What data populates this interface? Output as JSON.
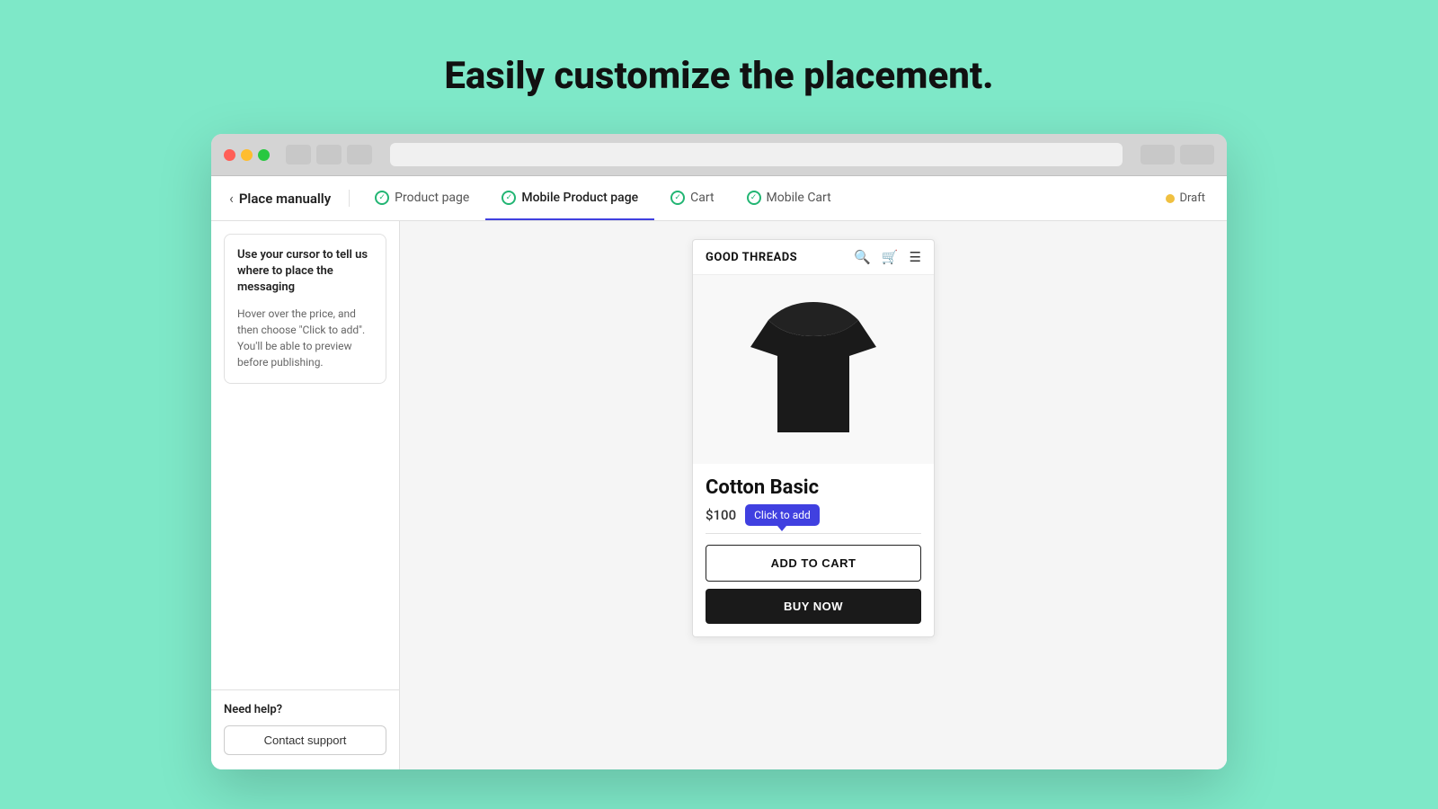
{
  "page": {
    "title": "Easily customize the placement.",
    "background_color": "#7ee8c8"
  },
  "browser": {
    "traffic_lights": [
      "red",
      "yellow",
      "green"
    ]
  },
  "app": {
    "back_label": "Place manually",
    "tabs": [
      {
        "id": "product-page",
        "label": "Product page",
        "active": false,
        "check": true
      },
      {
        "id": "mobile-product-page",
        "label": "Mobile Product page",
        "active": true,
        "check": true
      },
      {
        "id": "cart",
        "label": "Cart",
        "active": false,
        "check": true
      },
      {
        "id": "mobile-cart",
        "label": "Mobile Cart",
        "active": false,
        "check": true
      }
    ],
    "draft_badge": "Draft"
  },
  "sidebar": {
    "info_title": "Use your cursor to tell us where to place the messaging",
    "info_desc": "Hover over the price, and then choose \"Click to add\". You'll be able to preview before publishing.",
    "help_label": "Need help?",
    "contact_support_label": "Contact support"
  },
  "product": {
    "store_name": "GOOD THREADS",
    "name": "Cotton Basic",
    "price": "$100",
    "click_to_add_label": "Click to add",
    "add_to_cart_label": "ADD TO CART",
    "buy_now_label": "BUY NOW"
  }
}
